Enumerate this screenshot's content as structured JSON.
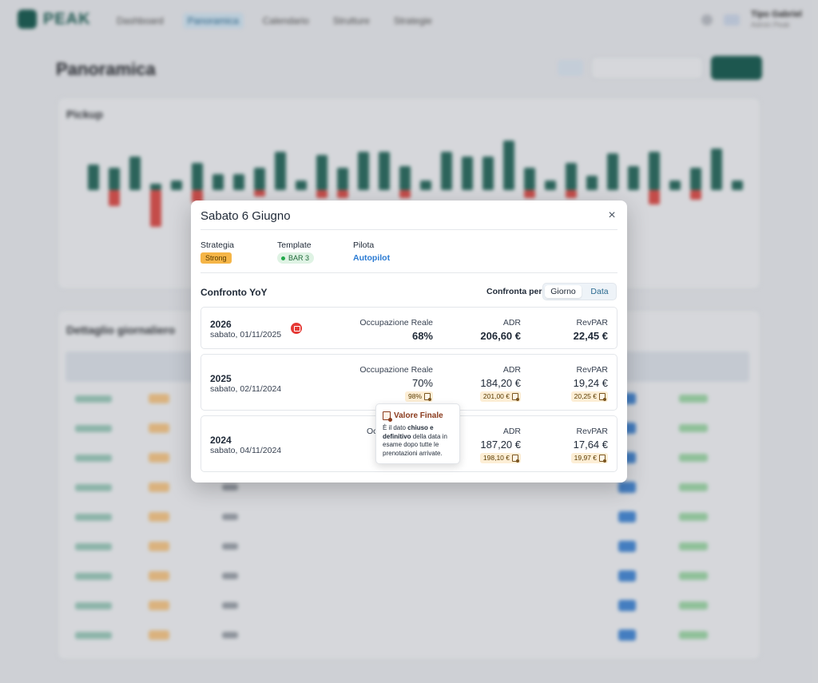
{
  "app": {
    "logo_text": "PEAK",
    "nav": [
      "Dashboard",
      "Panoramica",
      "Calendario",
      "Strutture",
      "Strategie"
    ],
    "user_name": "Tipo Gabriel",
    "user_role": "Admin Peak"
  },
  "page": {
    "title": "Panoramica",
    "pickup_title": "Pickup",
    "detail_title": "Dettaglio giornaliero"
  },
  "modal": {
    "title": "Sabato 6 Giugno",
    "close_icon": "×",
    "meta": {
      "strategy_label": "Strategia",
      "strategy_value": "Strong",
      "template_label": "Template",
      "template_value": "BAR 3",
      "pilot_label": "Pilota",
      "pilot_value": "Autopilot"
    },
    "yoy": {
      "title": "Confronto YoY",
      "compare_label": "Confronta per",
      "options": [
        "Giorno",
        "Data"
      ],
      "rows": [
        {
          "year": "2026",
          "date": "sabato, 01/11/2025",
          "occ_label": "Occupazione Reale",
          "occ_value": "68%",
          "adr_label": "ADR",
          "adr_value": "206,60 €",
          "revpar_label": "RevPAR",
          "revpar_value": "22,45 €"
        },
        {
          "year": "2025",
          "date": "sabato, 02/11/2024",
          "occ_label": "Occupazione Reale",
          "occ_value": "70%",
          "occ_final": "98%",
          "adr_label": "ADR",
          "adr_value": "184,20 €",
          "adr_final": "201,00 €",
          "revpar_label": "RevPAR",
          "revpar_value": "19,24 €",
          "revpar_final": "20,25 €"
        },
        {
          "year": "2024",
          "date": "sabato, 04/11/2024",
          "occ_label": "Oc",
          "adr_label": "ADR",
          "adr_value": "187,20 €",
          "adr_final": "198,10 €",
          "revpar_label": "RevPAR",
          "revpar_value": "17,64 €",
          "revpar_final": "19,97 €"
        }
      ]
    },
    "tooltip": {
      "title": "Valore Finale",
      "text_1": "È il dato ",
      "bold_1": "chiuso e definitivo",
      "text_2": " della data in esame dopo tutte le prenotazioni arrivate."
    }
  },
  "colors": {
    "brand": "#1f5f55",
    "strategy_badge": "#f5b547",
    "link": "#2b7bd3",
    "tooltip_title": "#8a3a1c"
  }
}
